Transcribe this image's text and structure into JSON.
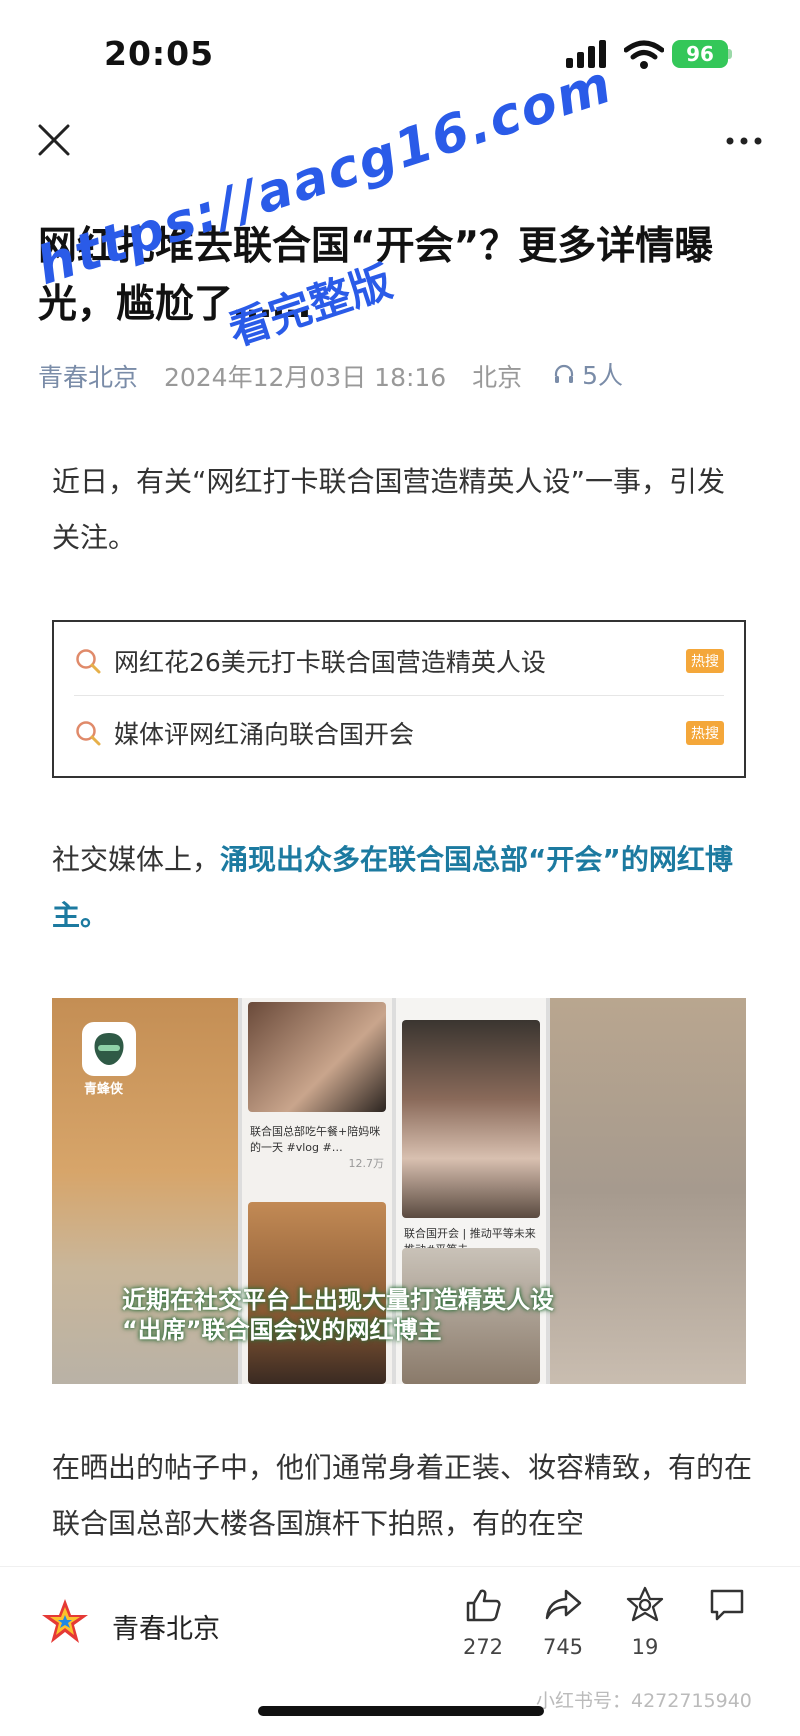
{
  "status_bar": {
    "time": "20:05",
    "battery": "96"
  },
  "article": {
    "title": "网红扎堆去联合国“开会”？更多详情曝光，尴尬了……",
    "author": "青春北京",
    "date": "2024年12月03日 18:16",
    "location": "北京",
    "listeners": "5人",
    "paragraph1": "近日，有关“网红打卡联合国营造精英人设”一事，引发关注。",
    "paragraph2_plain": "社交媒体上，",
    "paragraph2_highlight": "涌现出众多在联合国总部“开会”的网红博主。",
    "paragraph3": "在晒出的帖子中，他们通常身着正装、妆容精致，有的在联合国总部大楼各国旗杆下拍照，有的在空"
  },
  "hot_search": {
    "items": [
      {
        "text": "网红花26美元打卡联合国营造精英人设",
        "badge": "热搜"
      },
      {
        "text": "媒体评网红涌向联合国开会",
        "badge": "热搜"
      }
    ]
  },
  "collage": {
    "app_name": "青蜂侠",
    "caption1": "联合国总部吃午餐+陪妈咪的一天 #vlog #…",
    "caption1_count": "12.7万",
    "caption2": "联合国开会 | 推动平等未来 推动#平等未",
    "overlay_line1": "近期在社交平台上出现大量打造精英人设",
    "overlay_line2": "“出席”联合国会议的网红博主"
  },
  "watermark": {
    "line1": "https://aacg16.com",
    "line2": "看完整版"
  },
  "bottom_bar": {
    "account": "青春北京",
    "likes": "272",
    "shares": "745",
    "favorites": "19",
    "comments": ""
  },
  "xhs_mark": "小红书号：427271​5940",
  "colors": {
    "highlight": "#1c7aa0",
    "hot_badge": "#f4a73a",
    "battery": "#34c759",
    "watermark": "#2a5be8"
  }
}
